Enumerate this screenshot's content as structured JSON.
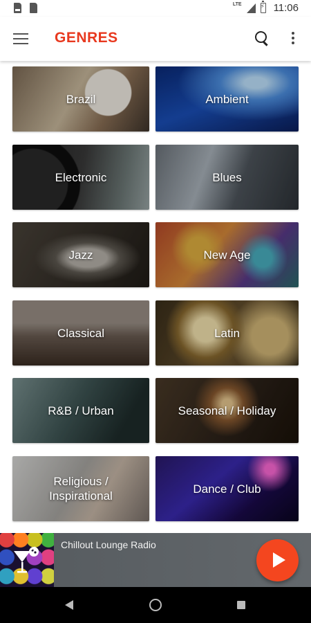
{
  "status_bar": {
    "network": "LTE",
    "time": "11:06"
  },
  "app_bar": {
    "title": "GENRES",
    "accent_color": "#e8391f"
  },
  "icons": {
    "menu": "hamburger-menu-icon",
    "search": "search-icon",
    "overflow": "more-vert-icon",
    "play": "play-icon",
    "back": "back-icon",
    "home": "home-icon",
    "recents": "recents-icon"
  },
  "genres": [
    {
      "label": "Brazil"
    },
    {
      "label": "Ambient"
    },
    {
      "label": "Electronic"
    },
    {
      "label": "Blues"
    },
    {
      "label": "Jazz"
    },
    {
      "label": "New Age"
    },
    {
      "label": "Classical"
    },
    {
      "label": "Latin"
    },
    {
      "label": "R&B / Urban"
    },
    {
      "label": "Seasonal / Holiday"
    },
    {
      "label": "Religious / Inspirational"
    },
    {
      "label": "Dance / Club"
    }
  ],
  "player": {
    "station_name": "Chillout Lounge Radio",
    "fab_color": "#f4461f"
  }
}
